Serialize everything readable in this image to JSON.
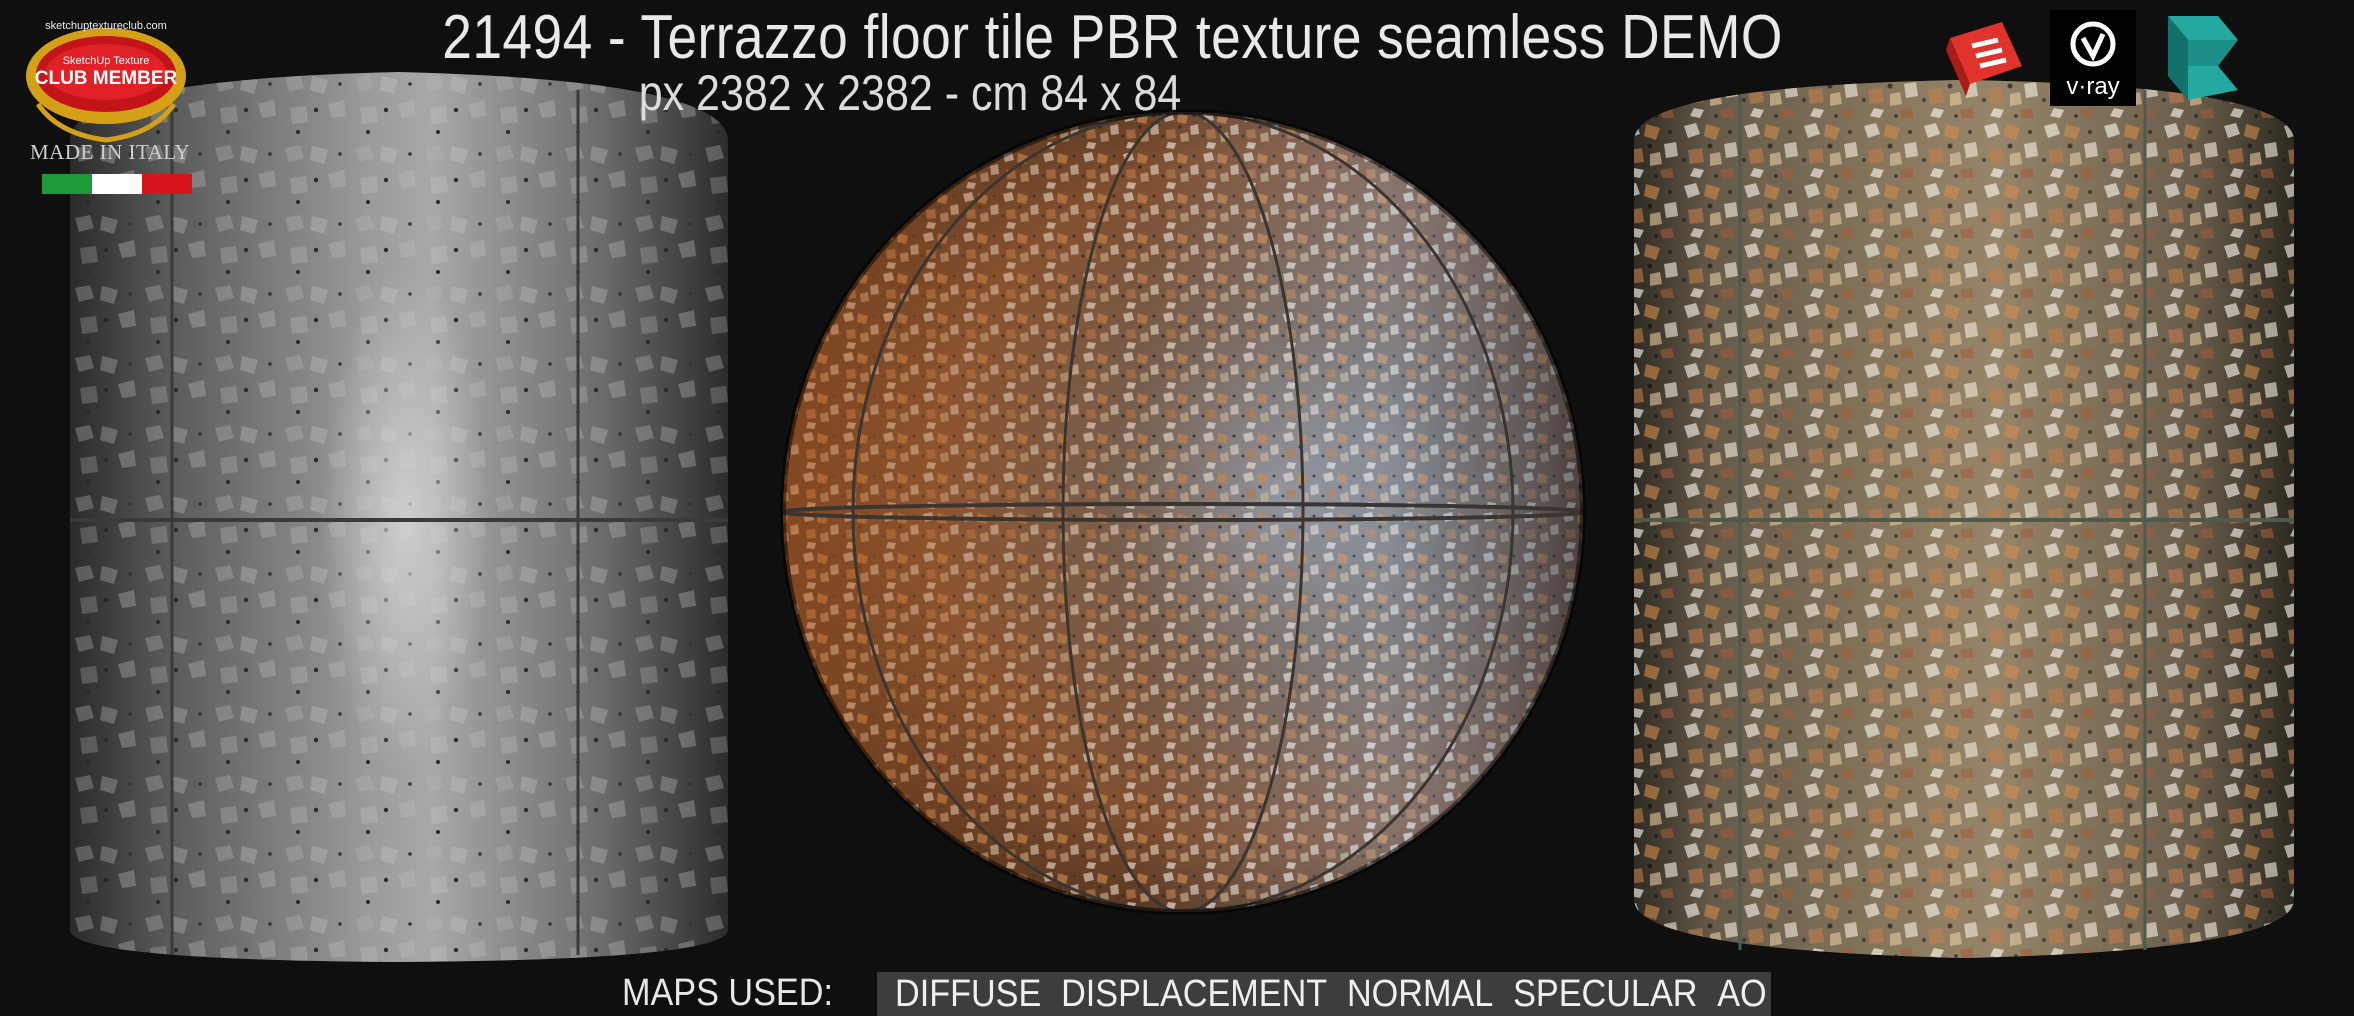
{
  "header": {
    "title": "21494 - Terrazzo floor tile PBR texture seamless DEMO",
    "subtitle": "px 2382 x 2382 - cm 84 x 84"
  },
  "club_badge": {
    "text_top": "sketchuptextureclub.com",
    "text_mid": "SketchUp Texture",
    "text_main": "CLUB MEMBER"
  },
  "made_in": "MADE IN ITALY",
  "flag_colors": [
    "#1e9a3a",
    "#ffffff",
    "#d8141c"
  ],
  "brands": [
    {
      "name": "sketchup-icon",
      "color": "#e0332c"
    },
    {
      "name": "vray-icon",
      "label": "v·ray",
      "color": "#111111"
    },
    {
      "name": "3dsmax-icon",
      "color": "#1f9a93"
    }
  ],
  "maps": {
    "label": "MAPS USED:",
    "items": [
      "DIFFUSE",
      "DISPLACEMENT",
      "NORMAL",
      "SPECULAR",
      "AO"
    ]
  }
}
